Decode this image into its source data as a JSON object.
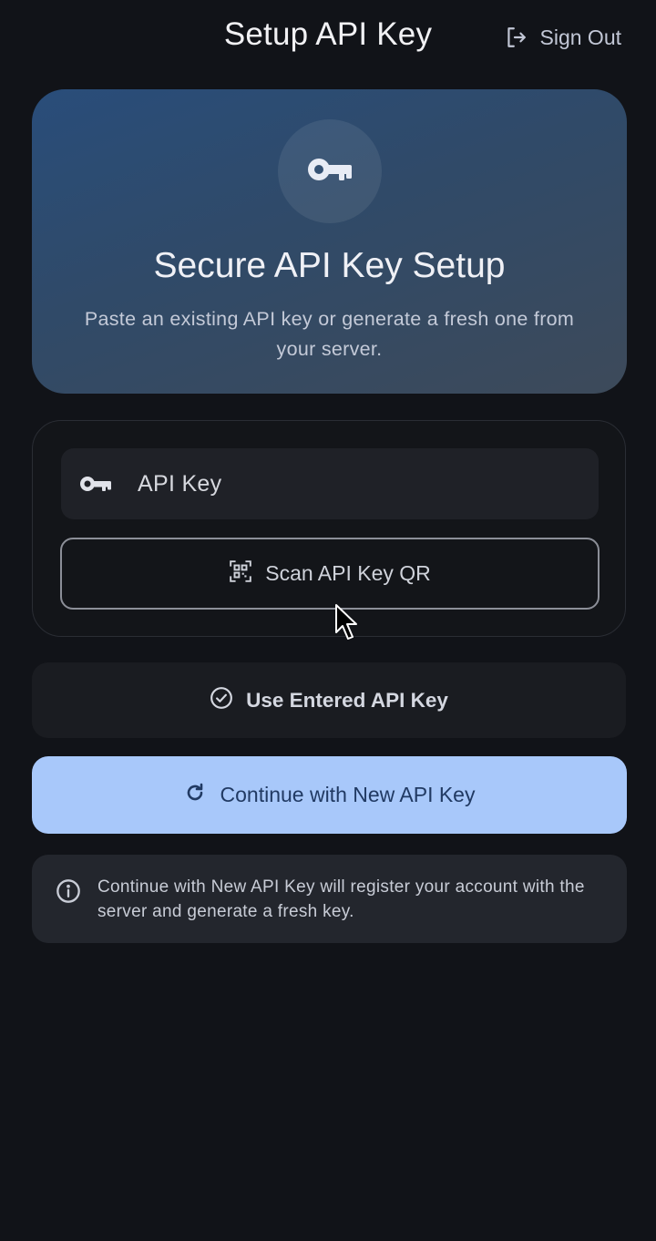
{
  "header": {
    "title": "Setup API Key",
    "sign_out_label": "Sign Out",
    "sign_out_icon": "logout-icon"
  },
  "hero": {
    "icon": "key-icon",
    "title": "Secure API Key Setup",
    "description": "Paste an existing API key or generate a fresh one from your server."
  },
  "form": {
    "api_key_label": "API Key",
    "api_key_icon": "key-icon",
    "scan_button_label": "Scan API Key QR",
    "scan_icon": "qr-scan-icon"
  },
  "actions": {
    "use_entered_label": "Use Entered API Key",
    "use_entered_icon": "check-circle-icon",
    "continue_new_label": "Continue with New API Key",
    "continue_new_icon": "refresh-icon"
  },
  "info": {
    "icon": "info-icon",
    "text": "Continue with New API Key will register your account with the server and generate a fresh key."
  },
  "colors": {
    "background": "#111318",
    "primary_button": "#a8c8fa",
    "primary_button_text": "#213a63",
    "hero_gradient_start": "#294d7a",
    "hero_gradient_end": "#3d4a5a"
  }
}
